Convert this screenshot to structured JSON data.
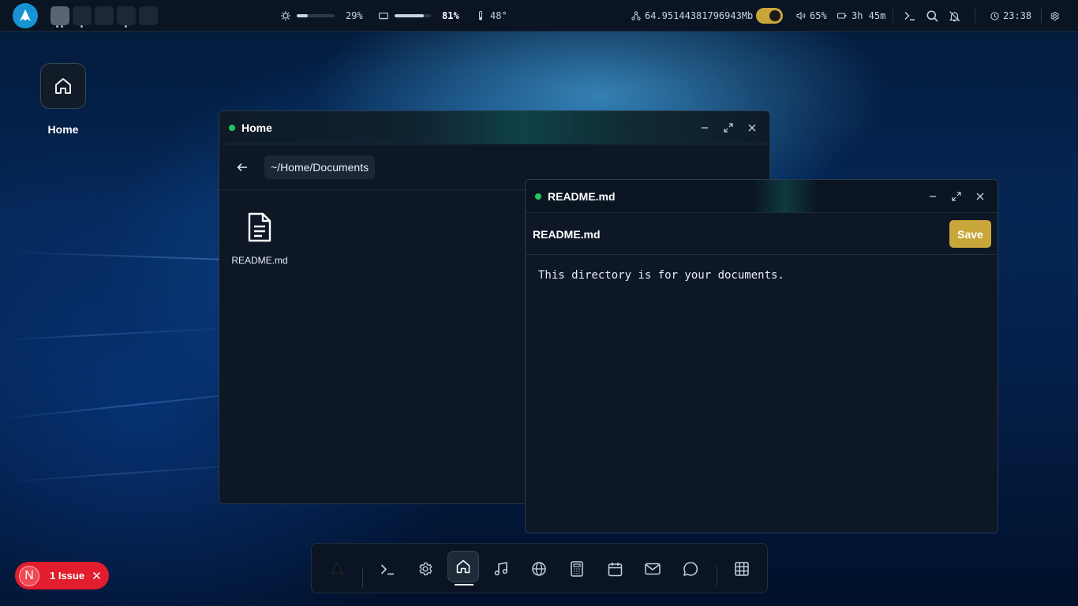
{
  "topbar": {
    "brightness_label": "29%",
    "brightness_level": 0.29,
    "memory_label": "81%",
    "memory_level": 0.81,
    "temperature": "48°",
    "network": "64.95144381796943Mb",
    "volume": "65%",
    "battery": "3h 45m",
    "clock": "23:38",
    "workspaces": [
      {
        "active": true
      },
      {
        "active": false
      },
      {
        "active": false
      },
      {
        "active": false
      },
      {
        "active": false
      }
    ]
  },
  "desktop": {
    "home_label": "Home"
  },
  "file_manager": {
    "title": "Home",
    "path": "~/Home/Documents",
    "files": [
      {
        "name": "README.md"
      }
    ]
  },
  "editor": {
    "title": "README.md",
    "file_name": "README.md",
    "save_label": "Save",
    "content": "This directory is for your documents."
  },
  "dock": {
    "items": [
      "arch-logo",
      "terminal",
      "settings",
      "home",
      "music",
      "browser",
      "calculator",
      "calendar",
      "mail",
      "chat",
      "apps-grid"
    ],
    "active": "home"
  },
  "issue_badge": {
    "avatar": "N",
    "label": "1 Issue"
  },
  "colors": {
    "accent": "#c9a63a",
    "status_green": "#22c55e",
    "issue_red": "#e11d2e",
    "arch_blue": "#1793d1"
  }
}
